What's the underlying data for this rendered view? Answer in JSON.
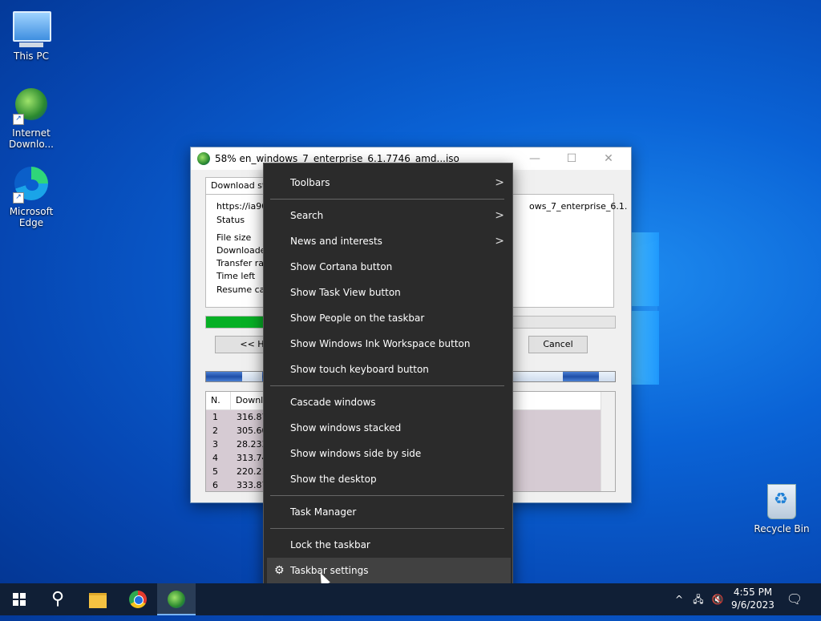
{
  "desktop": {
    "icons": [
      {
        "label": "This PC"
      },
      {
        "label": "Internet Downlo..."
      },
      {
        "label": "Microsoft Edge"
      },
      {
        "label": "Recycle Bin"
      }
    ]
  },
  "idm_window": {
    "title": "58% en_windows_7_enterprise_6.1.7746_amd...iso",
    "tab": "Download sta",
    "url_left": "https://ia90",
    "url_right": "ows_7_enterprise_6.1.",
    "labels": [
      "Status",
      "File size",
      "Downloaded",
      "Transfer rat",
      "Time left",
      "Resume cap"
    ],
    "progress_percent": 58,
    "hide_button": "<< Hi",
    "cancel_button": "Cancel",
    "table": {
      "headers": [
        "N.",
        "Downlo"
      ],
      "rows": [
        [
          "1",
          "316.87"
        ],
        [
          "2",
          "305.60"
        ],
        [
          "3",
          "28.233"
        ],
        [
          "4",
          "313.74"
        ],
        [
          "5",
          "220.21"
        ],
        [
          "6",
          "333.87"
        ]
      ]
    }
  },
  "context_menu": {
    "items": [
      {
        "label": "Toolbars",
        "submenu": true
      },
      {
        "label": "Search",
        "submenu": true
      },
      {
        "label": "News and interests",
        "submenu": true
      },
      {
        "label": "Show Cortana button"
      },
      {
        "label": "Show Task View button"
      },
      {
        "label": "Show People on the taskbar"
      },
      {
        "label": "Show Windows Ink Workspace button"
      },
      {
        "label": "Show touch keyboard button"
      },
      {
        "label": "Cascade windows"
      },
      {
        "label": "Show windows stacked"
      },
      {
        "label": "Show windows side by side"
      },
      {
        "label": "Show the desktop"
      },
      {
        "label": "Task Manager"
      },
      {
        "label": "Lock the taskbar"
      },
      {
        "label": "Taskbar settings",
        "highlighted": true
      }
    ],
    "submenu_glyph": ">"
  },
  "taskbar": {
    "pinned": [
      "start-icon",
      "search-icon",
      "file-explorer-icon",
      "chrome-icon",
      "idm-icon"
    ],
    "tray": {
      "chevron": "^",
      "time": "4:55 PM",
      "date": "9/6/2023"
    }
  }
}
